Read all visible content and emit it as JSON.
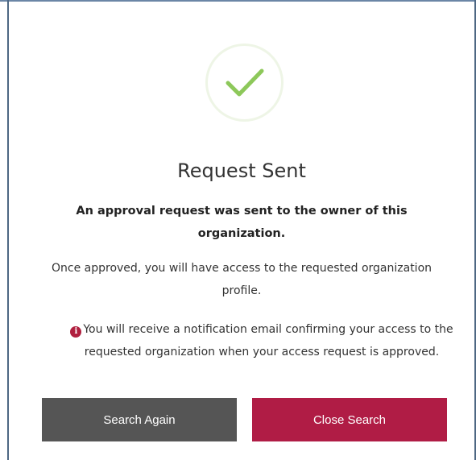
{
  "dialog": {
    "status_icon": "check-icon",
    "title": "Request Sent",
    "subtitle": "An approval request was sent to the owner of this organization.",
    "body": "Once approved, you will have access to the requested organization profile.",
    "notice_icon": "info-icon",
    "notice_icon_glyph": "i",
    "notice": "You will receive a notification email confirming your access to the requested organization when your access request is approved."
  },
  "buttons": {
    "search_again": "Search Again",
    "close_search": "Close Search"
  },
  "colors": {
    "check": "#8dc85a",
    "circle_border": "#eef5e6",
    "secondary_button": "#555555",
    "primary_button": "#b01c45",
    "info_icon": "#b0203f"
  }
}
